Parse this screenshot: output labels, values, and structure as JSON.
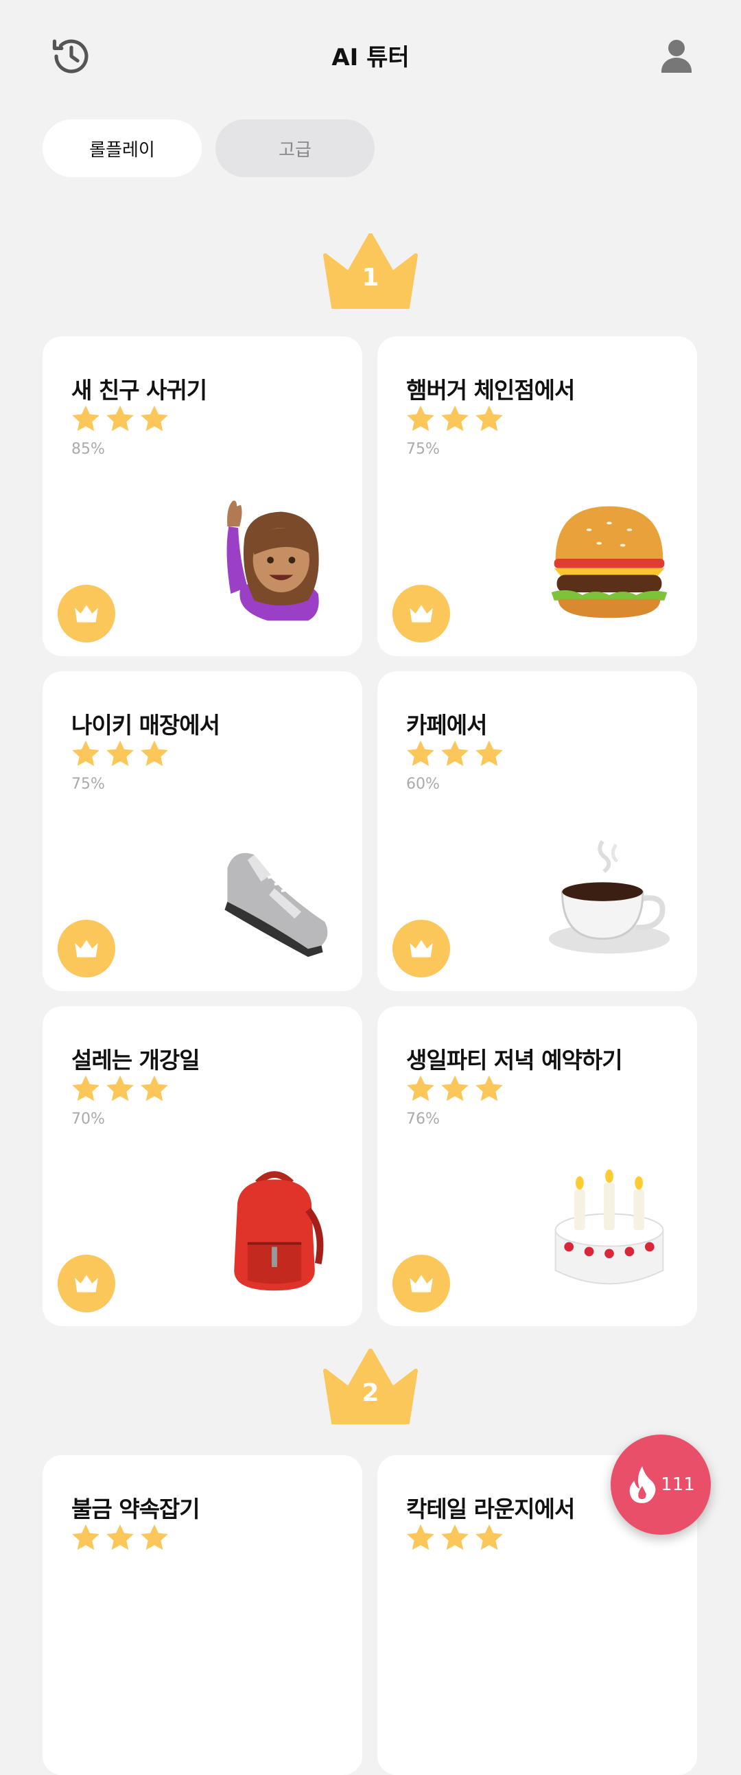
{
  "header": {
    "title": "AI 튜터",
    "history_icon": "history-icon",
    "profile_icon": "person-icon"
  },
  "tabs": [
    {
      "label": "롤플레이",
      "active": true
    },
    {
      "label": "고급",
      "active": false
    }
  ],
  "levels": [
    {
      "number": "1"
    },
    {
      "number": "2"
    }
  ],
  "cards": [
    {
      "title": "새 친구 사귀기",
      "percent": "85%",
      "stars": 3,
      "emoji": "woman-raising-hand"
    },
    {
      "title": "햄버거 체인점에서",
      "percent": "75%",
      "stars": 3,
      "emoji": "hamburger"
    },
    {
      "title": "나이키 매장에서",
      "percent": "75%",
      "stars": 3,
      "emoji": "sneaker"
    },
    {
      "title": "카페에서",
      "percent": "60%",
      "stars": 3,
      "emoji": "coffee-cup"
    },
    {
      "title": "설레는 개강일",
      "percent": "70%",
      "stars": 3,
      "emoji": "backpack"
    },
    {
      "title": "생일파티 저녁 예약하기",
      "percent": "76%",
      "stars": 3,
      "emoji": "birthday-cake"
    },
    {
      "title": "불금 약속잡기",
      "percent": "",
      "stars": 3,
      "emoji": ""
    },
    {
      "title": "칵테일 라운지에서",
      "percent": "",
      "stars": 3,
      "emoji": ""
    }
  ],
  "fab": {
    "count": "111",
    "icon": "flame-icon"
  },
  "colors": {
    "accent": "#fbc75a",
    "fab": "#ea4f6a",
    "background": "#f2f2f3"
  }
}
